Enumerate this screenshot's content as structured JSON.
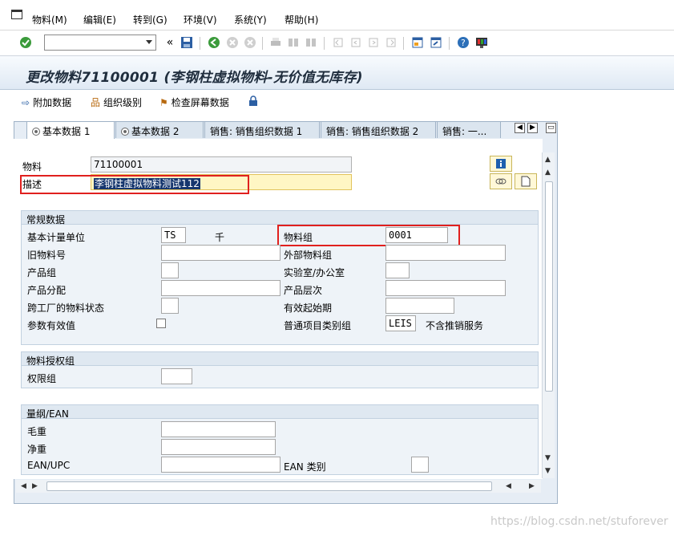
{
  "menu": [
    "物料(M)",
    "编辑(E)",
    "转到(G)",
    "环境(V)",
    "系统(Y)",
    "帮助(H)"
  ],
  "toolbar": {
    "command_value": "",
    "back_glyph": "«"
  },
  "title": "更改物料71100001 (李钢柱虚拟物料-无价值无库存)",
  "app_toolbar": {
    "additional_data": "附加数据",
    "org_levels": "组织级别",
    "check_screen_data": "检查屏幕数据"
  },
  "tabs": [
    "基本数据 1",
    "基本数据 2",
    "销售: 销售组织数据 1",
    "销售: 销售组织数据 2",
    "销售: 一..."
  ],
  "header": {
    "material_label": "物料",
    "material_value": "71100001",
    "desc_label": "描述",
    "desc_value": "李钢柱虚拟物料测试112"
  },
  "general": {
    "section_title": "常规数据",
    "base_uom_label": "基本计量单位",
    "base_uom_value": "TS",
    "base_uom_text": "千",
    "matl_group_label": "物料组",
    "matl_group_value": "0001",
    "old_matnr_label": "旧物料号",
    "ext_matl_group_label": "外部物料组",
    "division_label": "产品组",
    "lab_office_label": "实验室/办公室",
    "alloc_label": "产品分配",
    "prod_hier_label": "产品层次",
    "x_plant_status_label": "跨工厂的物料状态",
    "valid_from_label": "有效起始期",
    "assign_eff_label": "参数有效值",
    "gen_item_cat_label": "普通项目类别组",
    "gen_item_cat_value": "LEIS",
    "gen_item_cat_text": "不含推销服务"
  },
  "auth": {
    "section_title": "物料授权组",
    "auth_group_label": "权限组"
  },
  "dims": {
    "section_title": "量纲/EAN",
    "gross_weight_label": "毛重",
    "net_weight_label": "净重",
    "ean_label": "EAN/UPC",
    "ean_cat_label": "EAN 类别"
  },
  "watermark": "https://blog.csdn.net/stuforever"
}
